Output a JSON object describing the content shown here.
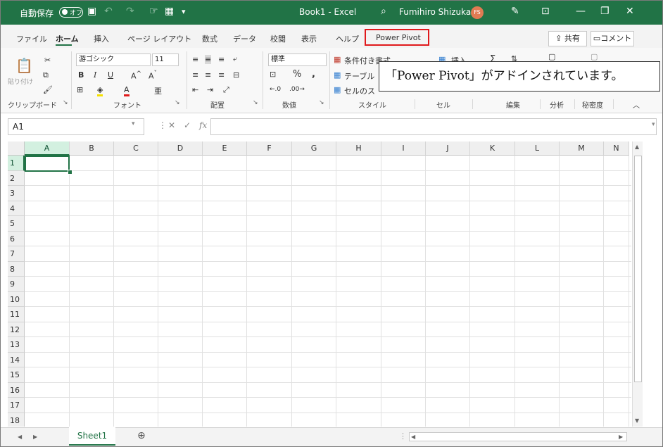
{
  "titlebar": {
    "autosave_label": "自動保存",
    "autosave_state": "オフ",
    "title": "Book1  -  Excel",
    "user_name": "Fumihiro Shizuka",
    "user_initials": "FS"
  },
  "tabs": {
    "items": [
      "ファイル",
      "ホーム",
      "挿入",
      "ページ レイアウト",
      "数式",
      "データ",
      "校閲",
      "表示",
      "ヘルプ"
    ],
    "active": "ホーム",
    "power_pivot": "Power Pivot",
    "share": "共有",
    "comment": "コメント"
  },
  "ribbon": {
    "paste_label": "貼り付け",
    "font_name": "游ゴシック",
    "font_size": "11",
    "number_format": "標準",
    "cond_format": "条件付き書式",
    "table_format": "テーブル",
    "cell_styles": "セルのス",
    "insert_label": "挿入",
    "groups": {
      "clipboard": "クリップボード",
      "font": "フォント",
      "alignment": "配置",
      "number": "数値",
      "styles": "スタイル",
      "cells": "セル",
      "editing": "編集",
      "analysis": "分析",
      "sensitivity": "秘密度"
    }
  },
  "callout": "「Power Pivot」がアドインされています。",
  "formula_bar": {
    "name_box": "A1",
    "fx": "fx",
    "value": ""
  },
  "grid": {
    "columns": [
      "A",
      "B",
      "C",
      "D",
      "E",
      "F",
      "G",
      "H",
      "I",
      "J",
      "K",
      "L",
      "M",
      "N"
    ],
    "rows": [
      "1",
      "2",
      "3",
      "4",
      "5",
      "6",
      "7",
      "8",
      "9",
      "10",
      "11",
      "12",
      "13",
      "14",
      "15",
      "16",
      "17",
      "18"
    ],
    "active_cell": "A1"
  },
  "sheets": {
    "tabs": [
      "Sheet1"
    ],
    "add_sheet": "⊕"
  },
  "colors": {
    "accent": "#217346",
    "highlight_box": "#e0191c"
  }
}
